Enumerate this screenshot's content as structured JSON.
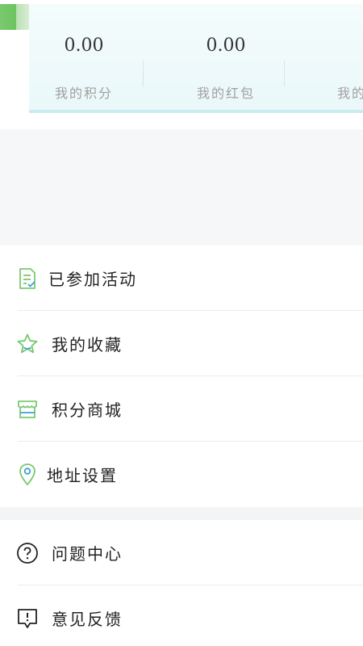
{
  "stats": [
    {
      "value": "0.00",
      "label": "我的积分"
    },
    {
      "value": "0.00",
      "label": "我的红包"
    },
    {
      "value": "",
      "label": "我的"
    }
  ],
  "menu_group_1": [
    {
      "label": "已参加活动",
      "icon": "document-check-icon"
    },
    {
      "label": "我的收藏",
      "icon": "star-icon"
    },
    {
      "label": "积分商城",
      "icon": "store-icon"
    },
    {
      "label": "地址设置",
      "icon": "location-pin-icon"
    }
  ],
  "menu_group_2": [
    {
      "label": "问题中心",
      "icon": "question-circle-icon"
    },
    {
      "label": "意见反馈",
      "icon": "feedback-icon"
    }
  ],
  "colors": {
    "accent_green": "#7bc96f",
    "card_bg": "#eaf8f9",
    "divider": "#ececec",
    "page_gap": "#f6f7f9"
  }
}
